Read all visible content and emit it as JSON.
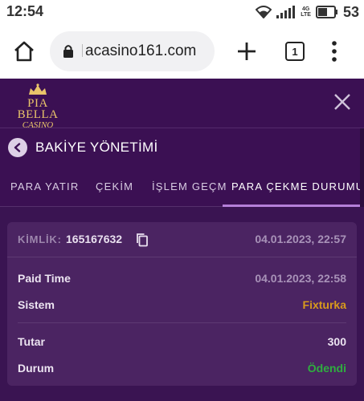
{
  "status_bar": {
    "time": "12:54",
    "battery": "53",
    "network_top": "4G",
    "network_bottom": "LTE"
  },
  "browser": {
    "url": "acasino161.com",
    "tab_count": "1",
    "icons": [
      "home-icon",
      "lock-icon",
      "plus-icon",
      "tabs-icon",
      "more-vert-icon"
    ]
  },
  "app": {
    "logo_top": "PIA BELLA",
    "logo_bottom": "CASINO",
    "close_icon": "close-icon"
  },
  "page": {
    "title": "BAKİYE YÖNETİMİ"
  },
  "tabs": [
    {
      "label": "PARA YATIR",
      "active": false
    },
    {
      "label": "ÇEKİM",
      "active": false
    },
    {
      "label": "İŞLEM GEÇM",
      "active": false
    },
    {
      "label": "PARA ÇEKME DURUMU",
      "active": true
    }
  ],
  "transaction": {
    "kimlik_label": "KİMLİK:",
    "kimlik_value": "165167632",
    "created_at": "04.01.2023, 22:57",
    "rows": [
      {
        "label": "Paid Time",
        "value": "04.01.2023, 22:58",
        "color": "#a892b8"
      },
      {
        "label": "Sistem",
        "value": "Fixturka",
        "color": "#d89a1c"
      },
      {
        "label": "Tutar",
        "value": "300",
        "color": "#ece4f1"
      },
      {
        "label": "Durum",
        "value": "Ödendi",
        "color": "#2fae3f"
      }
    ]
  },
  "colors": {
    "background": "#3a1452",
    "header": "#3b1053",
    "card": "#4b2462",
    "accent_gold": "#e9c46a",
    "tab_underline": "#b57fd9"
  }
}
